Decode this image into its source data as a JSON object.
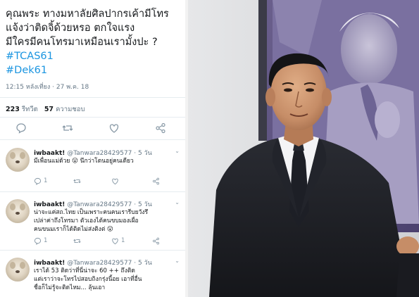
{
  "tweet": {
    "lines": [
      "คุณพระ ทางมหาลัยศิลปากรเค้ามีโทร",
      "แจ้งว่าติดจิ้ด้วยหรอ ตกใจแรง",
      "มีใครมีคนโทรมาเหมือนเรามั้งปะ ?"
    ],
    "hashtags": [
      "#TCAS61",
      "#Dek61"
    ],
    "timestamp": "12:15 หลังเที่ยง · 27 พ.ค. 18",
    "retweets_count": "223",
    "retweets_label": "รีทวีต",
    "likes_count": "57",
    "likes_label": "ความชอบ"
  },
  "replies": [
    {
      "name": "iwbaakt!",
      "handle": "@Tanwara28429577 · 5 วัน",
      "lines": [
        "มีเพื่อนแม่ด้วย 😮 นึกว่าโดนอยู่คนเดียว"
      ],
      "reply_count": "1",
      "like_count": ""
    },
    {
      "name": "iwbaakt!",
      "handle": "@Tanwara28429577 · 5 วัน",
      "lines": [
        "น่าจะแค่สถ.ไทย  เป็นเพราะคนคนเรารีบยวังรึ",
        "เปล่าค่าถึงโทรมา ตัวเองได้คนขบมองเผื่อ",
        "คนขนมเราก็ได้ติดไม่ส่งติงต่ 😮"
      ],
      "reply_count": "1",
      "like_count": "1"
    },
    {
      "name": "iwbaakt!",
      "handle": "@Tanwara28429577 · 5 วัน",
      "lines": [
        "เราได้ 53  ติดว่าที่นี่น่าจะ 60 ++ ถึงติด",
        "แต่เราว่าจะโทรไปสอบถิงกรุ่งนี้อย เอาที่อื่น",
        "ชื่อก็ไม่รู้จะติดไหม...  ลุ้นเอา"
      ],
      "reply_count": "",
      "like_count": ""
    }
  ]
}
